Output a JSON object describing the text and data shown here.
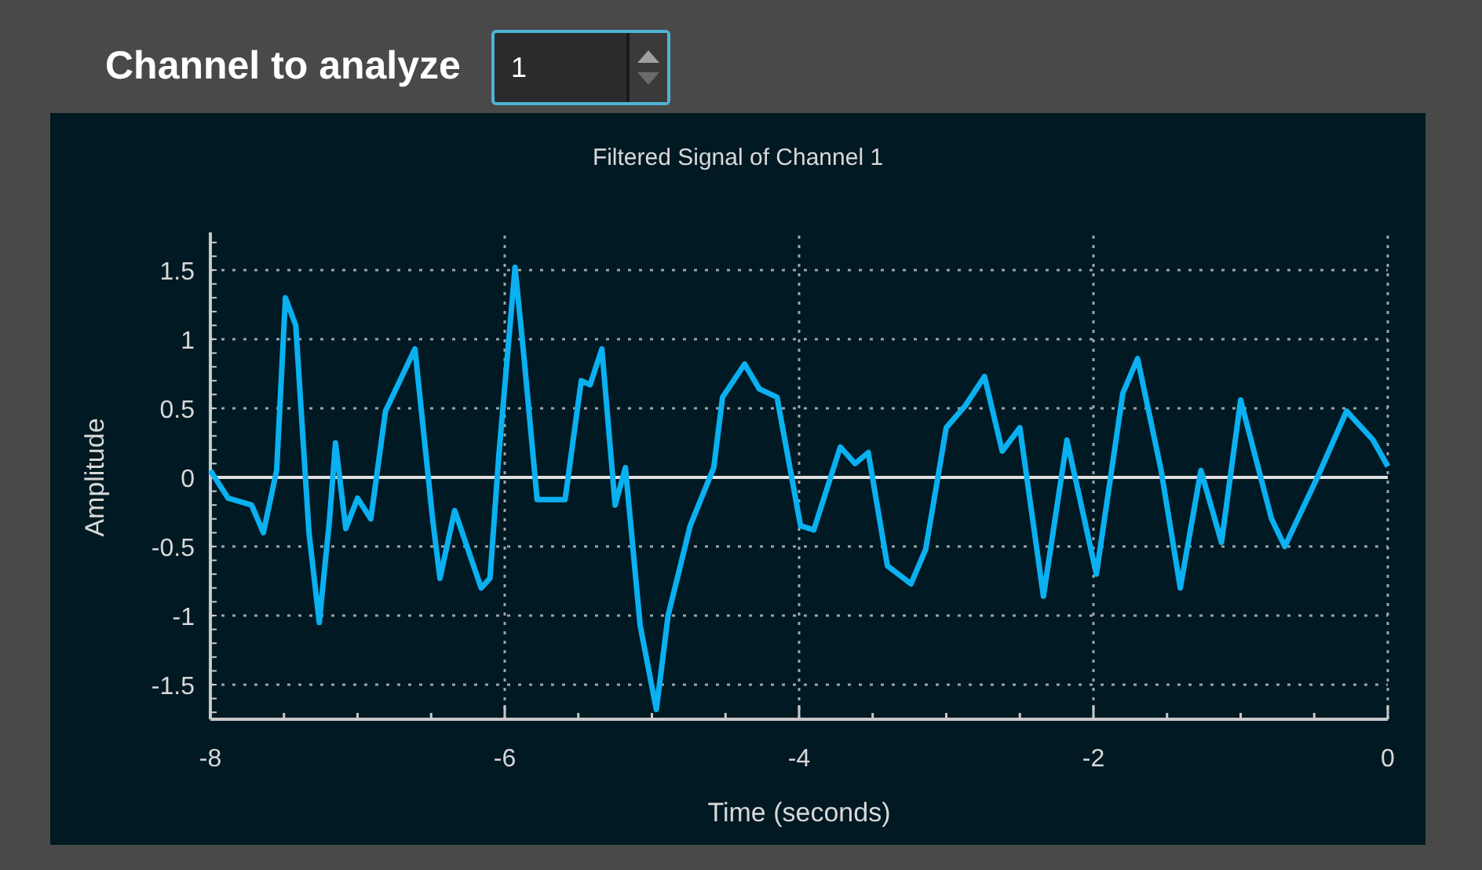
{
  "channel_selector": {
    "label": "Channel to analyze",
    "value": "1"
  },
  "plot": {
    "chart_data": {
      "type": "line",
      "title": "Filtered Signal of Channel 1",
      "xlabel": "Time (seconds)",
      "ylabel": "Amplitude",
      "xlim": [
        -8,
        0
      ],
      "ylim": [
        -1.75,
        1.75
      ],
      "xticks": [
        -8,
        -6,
        -4,
        -2,
        0
      ],
      "yticks": [
        -1.5,
        -1,
        -0.5,
        0,
        0.5,
        1,
        1.5
      ],
      "x": [
        -8.0,
        -7.88,
        -7.72,
        -7.64,
        -7.55,
        -7.49,
        -7.42,
        -7.33,
        -7.26,
        -7.19,
        -7.15,
        -7.08,
        -7.0,
        -6.91,
        -6.81,
        -6.61,
        -6.49,
        -6.44,
        -6.34,
        -6.16,
        -6.1,
        -6.04,
        -5.93,
        -5.87,
        -5.78,
        -5.67,
        -5.59,
        -5.48,
        -5.42,
        -5.34,
        -5.25,
        -5.18,
        -5.08,
        -4.97,
        -4.89,
        -4.74,
        -4.58,
        -4.52,
        -4.37,
        -4.27,
        -4.15,
        -3.99,
        -3.9,
        -3.72,
        -3.62,
        -3.53,
        -3.4,
        -3.24,
        -3.14,
        -3.0,
        -2.87,
        -2.74,
        -2.62,
        -2.5,
        -2.34,
        -2.18,
        -1.98,
        -1.8,
        -1.7,
        -1.54,
        -1.41,
        -1.27,
        -1.13,
        -1.0,
        -0.79,
        -0.7,
        -0.47,
        -0.28,
        -0.1,
        0
      ],
      "grid": true,
      "series": [
        {
          "color": "#0ab0f0",
          "values": [
            0.05,
            -0.15,
            -0.2,
            -0.4,
            0.05,
            1.3,
            1.1,
            -0.4,
            -1.05,
            -0.3,
            0.25,
            -0.37,
            -0.15,
            -0.3,
            0.48,
            0.93,
            -0.3,
            -0.73,
            -0.24,
            -0.8,
            -0.73,
            0.16,
            1.52,
            0.88,
            -0.16,
            -0.16,
            -0.16,
            0.7,
            0.67,
            0.93,
            -0.2,
            0.07,
            -1.07,
            -1.68,
            -1.0,
            -0.35,
            0.07,
            0.58,
            0.82,
            0.64,
            0.58,
            -0.35,
            -0.38,
            0.22,
            0.1,
            0.18,
            -0.64,
            -0.77,
            -0.52,
            0.36,
            0.52,
            0.73,
            0.19,
            0.36,
            -0.86,
            0.27,
            -0.7,
            0.61,
            0.86,
            0.05,
            -0.8,
            0.05,
            -0.47,
            0.56,
            -0.3,
            -0.5,
            0.02,
            0.48,
            0.27,
            0.08
          ]
        }
      ]
    }
  }
}
